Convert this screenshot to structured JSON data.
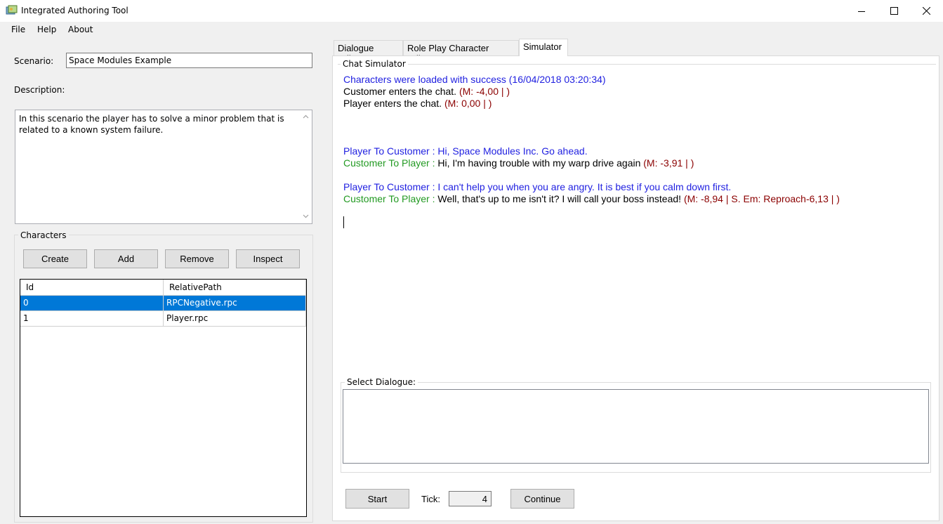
{
  "window": {
    "title": "Integrated Authoring Tool",
    "minimize_icon": "minimize-icon",
    "maximize_icon": "maximize-icon",
    "close_icon": "close-icon"
  },
  "menu": [
    "File",
    "Help",
    "About"
  ],
  "left": {
    "scenario_label": "Scenario:",
    "scenario_value": "Space Modules Example",
    "description_label": "Description:",
    "description_text": "In this scenario the player has to solve a minor problem that is related to a known system failure.",
    "characters_label": "Characters",
    "buttons": {
      "create": "Create",
      "add": "Add",
      "remove": "Remove",
      "inspect": "Inspect"
    },
    "grid": {
      "columns": [
        "Id",
        "RelativePath"
      ],
      "rows": [
        {
          "id": "0",
          "path": "RPCNegative.rpc",
          "selected": true
        },
        {
          "id": "1",
          "path": "Player.rpc",
          "selected": false
        }
      ]
    }
  },
  "tabs": [
    {
      "label": "Dialogue Editor",
      "active": false
    },
    {
      "label": "Role Play Character Editor",
      "active": false
    },
    {
      "label": "Simulator",
      "active": true
    }
  ],
  "simulator": {
    "chat_label": "Chat Simulator",
    "lines": {
      "l1": "Characters were loaded with success (16/04/2018 03:20:34)",
      "l2_text": "Customer enters the chat. ",
      "l2_mood": "(M: -4,00 | )",
      "l3_text": "Player enters the chat. ",
      "l3_mood": "(M: 0,00 | )",
      "l4_speaker": "Player To Customer : ",
      "l4_text": "Hi, Space Modules Inc. Go ahead.",
      "l5_speaker": "Customer To Player : ",
      "l5_text": "Hi, I'm having trouble with my warp drive again ",
      "l5_mood": "(M: -3,91 | )",
      "l6_speaker": "Player To Customer : ",
      "l6_text": "I can't help you when you are angry. It is best if you calm down first.",
      "l7_speaker": "Customer To Player : ",
      "l7_text": "Well, that's up to me isn't it? I will call your boss instead! ",
      "l7_mood": "(M: -8,94 | S. Em: Reproach-6,13 | )"
    },
    "select_dialogue_label": "Select Dialogue:",
    "start_label": "Start",
    "tick_label": "Tick:",
    "tick_value": "4",
    "continue_label": "Continue"
  }
}
